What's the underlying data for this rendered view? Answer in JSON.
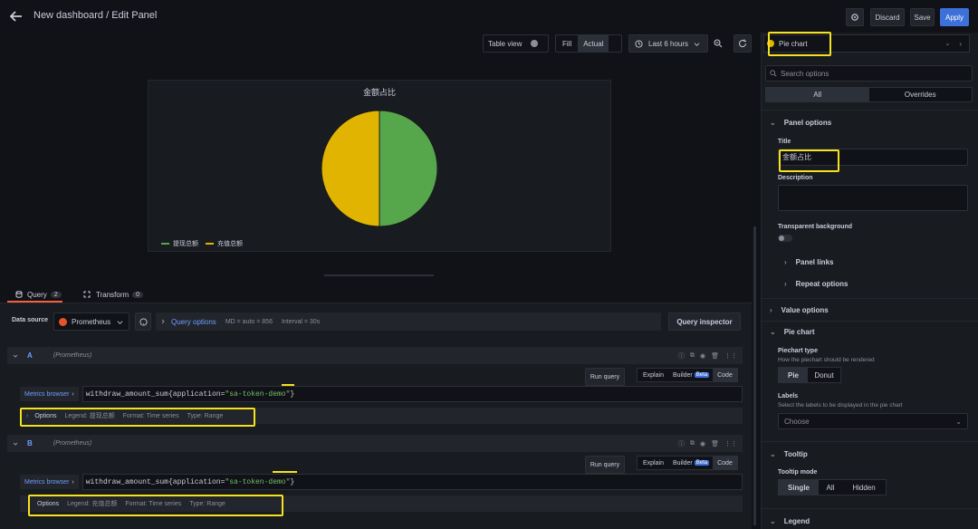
{
  "header": {
    "title": "New dashboard / Edit Panel",
    "discard": "Discard",
    "save": "Save",
    "apply": "Apply"
  },
  "toolbar": {
    "table_view": "Table view",
    "fill": "Fill",
    "actual": "Actual",
    "time_range": "Last 6 hours"
  },
  "panel": {
    "title": "金额占比",
    "legend": [
      {
        "label": "提现总额",
        "color": "#56a64b"
      },
      {
        "label": "充值总额",
        "color": "#e0b400"
      }
    ]
  },
  "chart_data": {
    "type": "pie",
    "title": "金额占比",
    "categories": [
      "提现总额",
      "充值总额"
    ],
    "values": [
      50,
      50
    ],
    "colors": [
      "#56a64b",
      "#e0b400"
    ]
  },
  "tabs": {
    "query": "Query",
    "query_count": "2",
    "transform": "Transform",
    "transform_count": "0"
  },
  "datasource": {
    "label": "Data source",
    "name": "Prometheus",
    "query_options": "Query options",
    "md": "MD = auto = 856",
    "interval": "Interval = 30s",
    "inspector": "Query inspector"
  },
  "queries": [
    {
      "letter": "A",
      "source": "(Prometheus)",
      "run": "Run query",
      "explain": "Explain",
      "builder": "Builder",
      "beta": "Beta",
      "code": "Code",
      "metrics_browser": "Metrics browser",
      "expr_prefix": "withdraw_amount_sum{",
      "expr_key": "application",
      "expr_eq": "=",
      "expr_val": "\"sa-token-demo\"",
      "expr_suffix": "}",
      "options": "Options",
      "legend": "Legend: 提现总额",
      "format": "Format: Time series",
      "type": "Type: Range"
    },
    {
      "letter": "B",
      "source": "(Prometheus)",
      "run": "Run query",
      "explain": "Explain",
      "builder": "Builder",
      "beta": "Beta",
      "code": "Code",
      "metrics_browser": "Metrics browser",
      "expr_prefix": "withdraw_amount_sum{",
      "expr_key": "application",
      "expr_eq": "=",
      "expr_val": "\"sa-token-demo\"",
      "expr_suffix": "}",
      "options": "Options",
      "legend": "Legend: 充值总额",
      "format": "Format: Time series",
      "type": "Type: Range"
    }
  ],
  "options_pane": {
    "viz": "Pie chart",
    "search_placeholder": "Search options",
    "all": "All",
    "overrides": "Overrides",
    "panel_options": "Panel options",
    "title_label": "Title",
    "title_value": "金额占比",
    "description_label": "Description",
    "transparent_label": "Transparent background",
    "panel_links": "Panel links",
    "repeat_options": "Repeat options",
    "value_options": "Value options",
    "pie_chart": "Pie chart",
    "piechart_type": "Piechart type",
    "piechart_type_desc": "How the piechart should be rendered",
    "pie": "Pie",
    "donut": "Donut",
    "labels": "Labels",
    "labels_desc": "Select the labels to be displayed in the pie chart",
    "choose": "Choose",
    "tooltip": "Tooltip",
    "tooltip_mode": "Tooltip mode",
    "single": "Single",
    "all_mode": "All",
    "hidden": "Hidden",
    "legend": "Legend"
  }
}
